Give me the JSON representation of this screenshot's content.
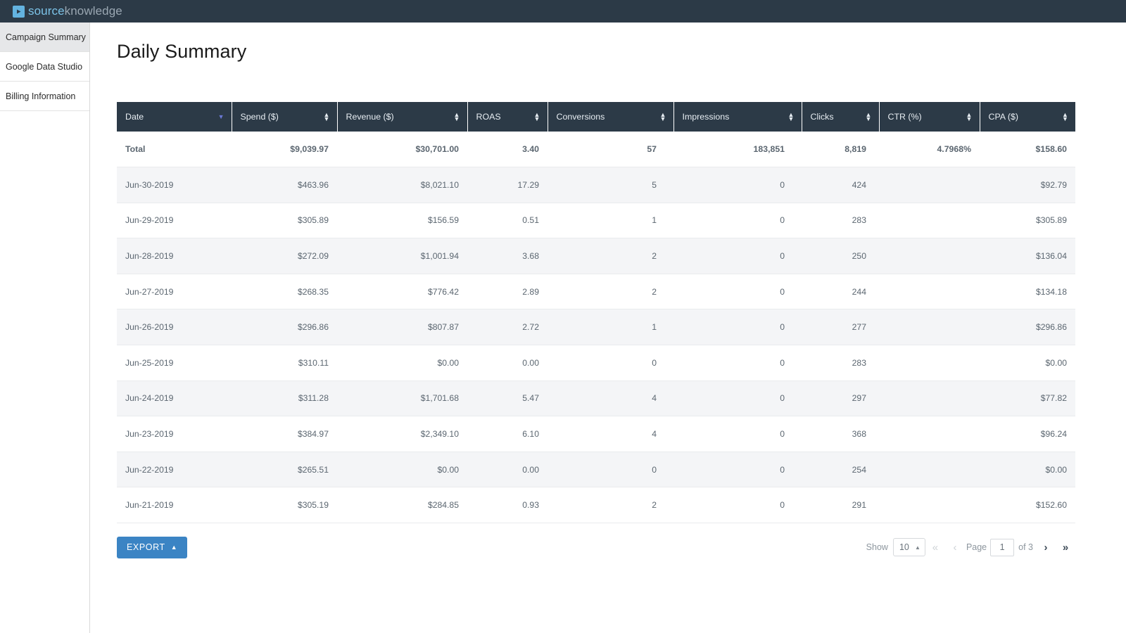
{
  "brand": {
    "logo_icon": "play-icon",
    "name_part1": "source",
    "name_part2": "knowledge",
    "bar_color": "#2c3a47",
    "accent_color": "#63b3e0"
  },
  "sidebar": {
    "items": [
      {
        "label": "Campaign Summary",
        "active": true
      },
      {
        "label": "Google Data Studio",
        "active": false
      },
      {
        "label": "Billing Information",
        "active": false
      }
    ]
  },
  "page": {
    "title": "Daily Summary"
  },
  "table": {
    "columns": [
      {
        "label": "Date",
        "sort": "desc"
      },
      {
        "label": "Spend ($)",
        "sort": "both"
      },
      {
        "label": "Revenue ($)",
        "sort": "both"
      },
      {
        "label": "ROAS",
        "sort": "both"
      },
      {
        "label": "Conversions",
        "sort": "both"
      },
      {
        "label": "Impressions",
        "sort": "both"
      },
      {
        "label": "Clicks",
        "sort": "both"
      },
      {
        "label": "CTR (%)",
        "sort": "both"
      },
      {
        "label": "CPA ($)",
        "sort": "both"
      }
    ],
    "total_row": {
      "label": "Total",
      "spend": "$9,039.97",
      "revenue": "$30,701.00",
      "roas": "3.40",
      "conversions": "57",
      "impressions": "183,851",
      "clicks": "8,819",
      "ctr": "4.7968%",
      "cpa": "$158.60"
    },
    "rows": [
      {
        "date": "Jun-30-2019",
        "spend": "$463.96",
        "revenue": "$8,021.10",
        "roas": "17.29",
        "conversions": "5",
        "impressions": "0",
        "clicks": "424",
        "ctr": "",
        "cpa": "$92.79"
      },
      {
        "date": "Jun-29-2019",
        "spend": "$305.89",
        "revenue": "$156.59",
        "roas": "0.51",
        "conversions": "1",
        "impressions": "0",
        "clicks": "283",
        "ctr": "",
        "cpa": "$305.89"
      },
      {
        "date": "Jun-28-2019",
        "spend": "$272.09",
        "revenue": "$1,001.94",
        "roas": "3.68",
        "conversions": "2",
        "impressions": "0",
        "clicks": "250",
        "ctr": "",
        "cpa": "$136.04"
      },
      {
        "date": "Jun-27-2019",
        "spend": "$268.35",
        "revenue": "$776.42",
        "roas": "2.89",
        "conversions": "2",
        "impressions": "0",
        "clicks": "244",
        "ctr": "",
        "cpa": "$134.18"
      },
      {
        "date": "Jun-26-2019",
        "spend": "$296.86",
        "revenue": "$807.87",
        "roas": "2.72",
        "conversions": "1",
        "impressions": "0",
        "clicks": "277",
        "ctr": "",
        "cpa": "$296.86"
      },
      {
        "date": "Jun-25-2019",
        "spend": "$310.11",
        "revenue": "$0.00",
        "roas": "0.00",
        "conversions": "0",
        "impressions": "0",
        "clicks": "283",
        "ctr": "",
        "cpa": "$0.00"
      },
      {
        "date": "Jun-24-2019",
        "spend": "$311.28",
        "revenue": "$1,701.68",
        "roas": "5.47",
        "conversions": "4",
        "impressions": "0",
        "clicks": "297",
        "ctr": "",
        "cpa": "$77.82"
      },
      {
        "date": "Jun-23-2019",
        "spend": "$384.97",
        "revenue": "$2,349.10",
        "roas": "6.10",
        "conversions": "4",
        "impressions": "0",
        "clicks": "368",
        "ctr": "",
        "cpa": "$96.24"
      },
      {
        "date": "Jun-22-2019",
        "spend": "$265.51",
        "revenue": "$0.00",
        "roas": "0.00",
        "conversions": "0",
        "impressions": "0",
        "clicks": "254",
        "ctr": "",
        "cpa": "$0.00"
      },
      {
        "date": "Jun-21-2019",
        "spend": "$305.19",
        "revenue": "$284.85",
        "roas": "0.93",
        "conversions": "2",
        "impressions": "0",
        "clicks": "291",
        "ctr": "",
        "cpa": "$152.60"
      }
    ]
  },
  "footer": {
    "export_label": "EXPORT",
    "export_caret": "caret-up-icon",
    "export_color": "#3b84c4",
    "show_label": "Show",
    "page_size": "10",
    "first_icon": "chevron-double-left-icon",
    "prev_icon": "chevron-left-icon",
    "page_label": "Page",
    "page_number": "1",
    "of_label": "of 3",
    "next_icon": "chevron-right-icon",
    "last_icon": "chevron-double-right-icon"
  }
}
